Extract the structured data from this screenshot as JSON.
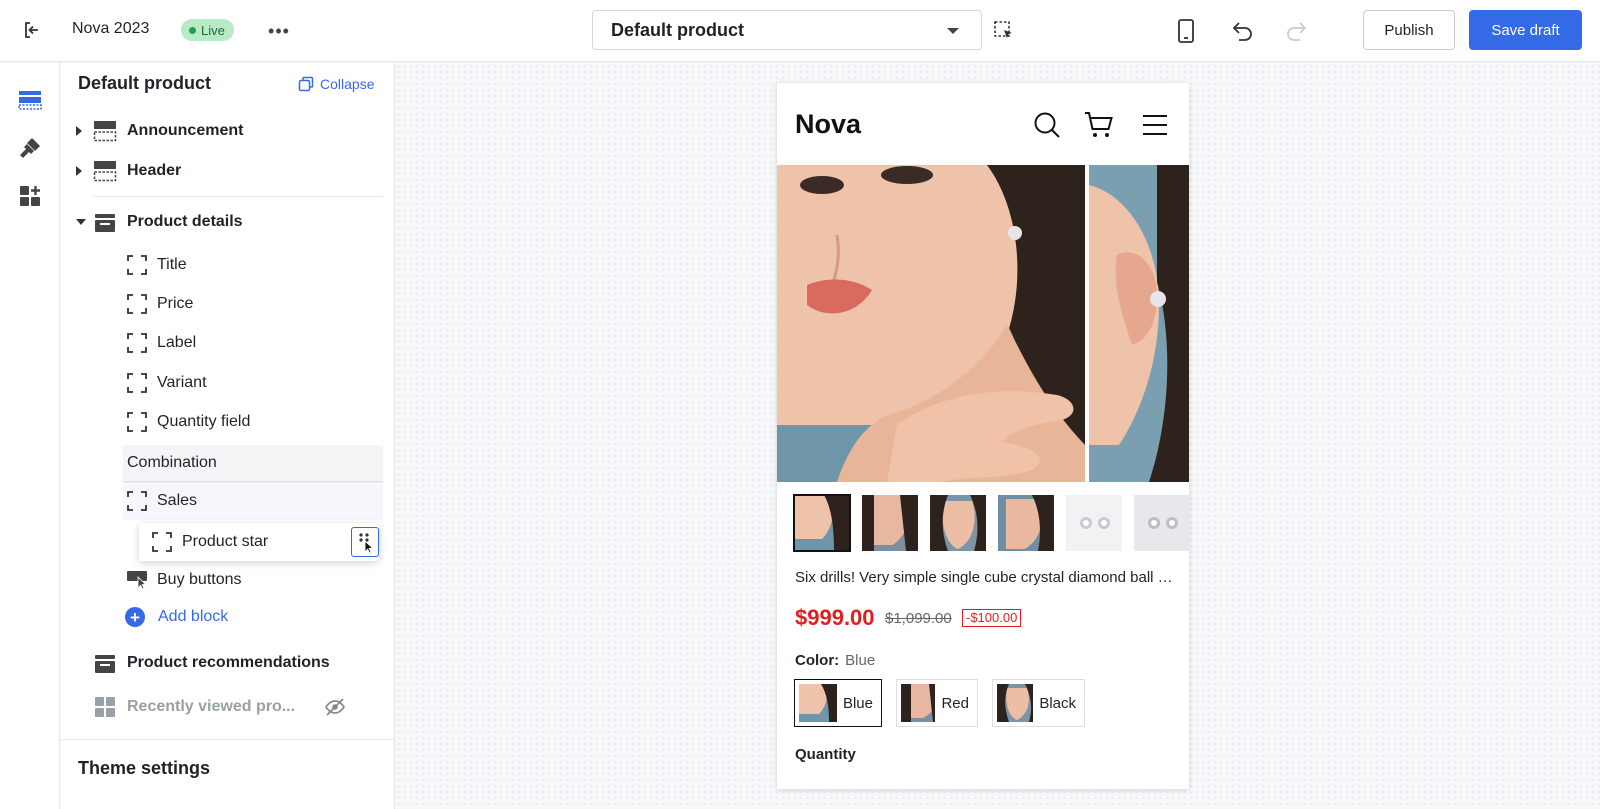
{
  "topbar": {
    "store_name": "Nova 2023",
    "status_badge": "Live",
    "template_select": "Default product",
    "publish_label": "Publish",
    "save_draft_label": "Save draft"
  },
  "sidebar": {
    "title": "Default product",
    "collapse_label": "Collapse",
    "sections": {
      "announcement": "Announcement",
      "header": "Header",
      "product_details": "Product details",
      "product_recommendations": "Product recommendations",
      "recently_viewed": "Recently viewed pro..."
    },
    "blocks": {
      "title": "Title",
      "price": "Price",
      "label": "Label",
      "variant": "Variant",
      "quantity_field": "Quantity field",
      "combination": "Combination",
      "sales": "Sales",
      "product_star": "Product star",
      "buy_buttons": "Buy buttons"
    },
    "add_block_label": "Add block",
    "theme_settings": "Theme settings"
  },
  "preview": {
    "logo": "Nova",
    "product_title": "Six drills! Very simple single cube crystal diamond ball ear studs",
    "price": "$999.00",
    "compare_price": "$1,099.00",
    "discount": "-$100.00",
    "color_label": "Color:",
    "color_value": "Blue",
    "colors": [
      "Blue",
      "Red",
      "Black"
    ],
    "quantity_label": "Quantity",
    "selected_thumb": 1
  },
  "colors": {
    "accent": "#356ae6",
    "live_badge": "#b7ebc6",
    "price_red": "#e02020"
  }
}
